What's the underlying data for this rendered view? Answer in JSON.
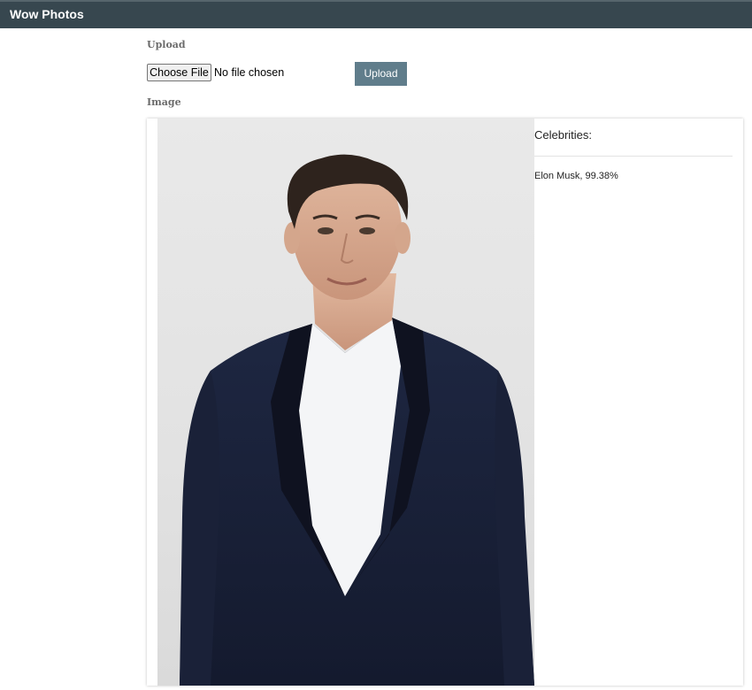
{
  "app": {
    "title": "Wow Photos"
  },
  "upload": {
    "section_label": "Upload",
    "file_button_label": "Choose File",
    "file_status": "No file chosen",
    "submit_label": "Upload"
  },
  "image": {
    "section_label": "Image",
    "photo_subject": "person-in-dark-suit-portrait"
  },
  "results": {
    "title": "Celebrities:",
    "items": [
      {
        "text": "Elon Musk, 99.38%"
      }
    ]
  },
  "colors": {
    "navbar": "#37474f",
    "button": "#607d8b"
  }
}
